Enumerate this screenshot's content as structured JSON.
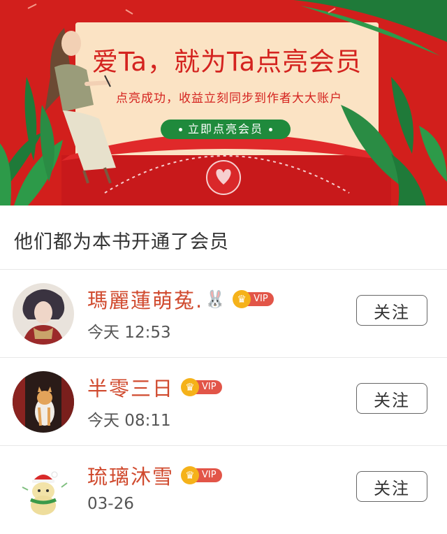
{
  "banner": {
    "title": "爱Ta，就为Ta点亮会员",
    "subtitle": "点亮成功，收益立刻同步到作者大大账户",
    "button_label": "立即点亮会员"
  },
  "section_title": "他们都为本书开通了会员",
  "members": [
    {
      "name": "瑪麗蓮萌菟.",
      "emoji": "🐰",
      "vip_label": "VIP",
      "time": "今天 12:53",
      "follow_label": "关注"
    },
    {
      "name": "半零三日",
      "vip_label": "VIP",
      "time": "今天 08:11",
      "follow_label": "关注"
    },
    {
      "name": "琉璃沐雪",
      "vip_label": "VIP",
      "time": "03-26",
      "follow_label": "关注"
    }
  ],
  "colors": {
    "banner_red": "#d21f1c",
    "name_color": "#d04a2e",
    "banner_button": "#1f8a3c",
    "vip_gold": "#f5b21a",
    "vip_red": "#e25548"
  }
}
